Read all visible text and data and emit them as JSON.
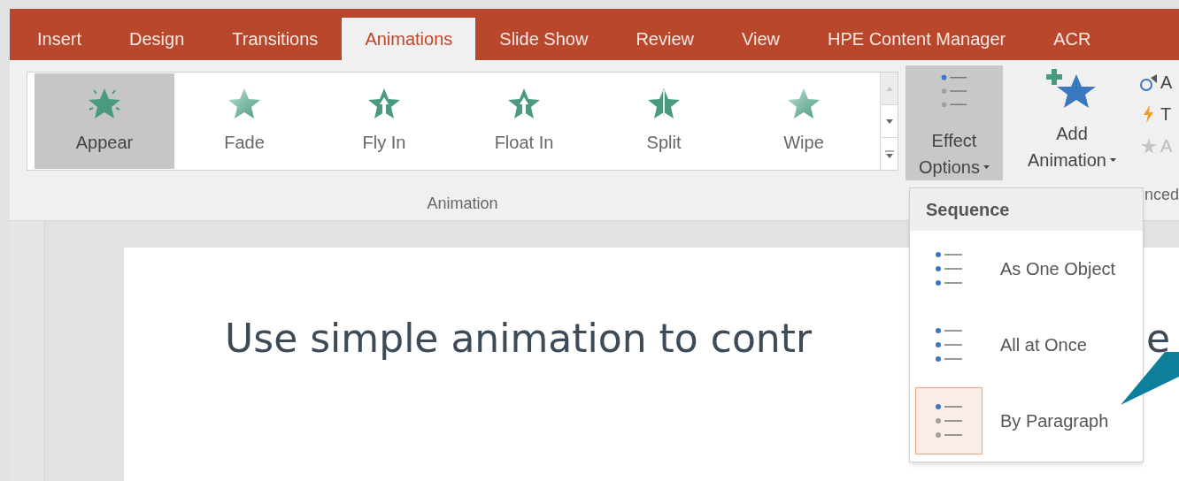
{
  "tabs": [
    {
      "label": "Insert",
      "selected": false
    },
    {
      "label": "Design",
      "selected": false
    },
    {
      "label": "Transitions",
      "selected": false
    },
    {
      "label": "Animations",
      "selected": true
    },
    {
      "label": "Slide Show",
      "selected": false
    },
    {
      "label": "Review",
      "selected": false
    },
    {
      "label": "View",
      "selected": false
    },
    {
      "label": "HPE Content Manager",
      "selected": false
    },
    {
      "label": "ACR",
      "selected": false
    }
  ],
  "animation_gallery": {
    "items": [
      {
        "label": "Appear",
        "kind": "appear",
        "selected": true
      },
      {
        "label": "Fade",
        "kind": "fade",
        "selected": false
      },
      {
        "label": "Fly In",
        "kind": "fly",
        "selected": false
      },
      {
        "label": "Float In",
        "kind": "float",
        "selected": false
      },
      {
        "label": "Split",
        "kind": "split",
        "selected": false
      },
      {
        "label": "Wipe",
        "kind": "wipe",
        "selected": false
      }
    ],
    "group_label": "Animation"
  },
  "effect_options": {
    "line1": "Effect",
    "line2": "Options",
    "selected": true
  },
  "add_animation": {
    "line1": "Add",
    "line2": "Animation"
  },
  "side_items": [
    {
      "kind": "timer",
      "label": "A",
      "disabled": false
    },
    {
      "kind": "trigger",
      "label": "T",
      "disabled": false
    },
    {
      "kind": "painter",
      "label": "A",
      "disabled": true
    }
  ],
  "advanced_group_label": "nced",
  "slide": {
    "title_visible": "Use simple animation to contr",
    "title_tail": "e"
  },
  "menu": {
    "header": "Sequence",
    "items": [
      {
        "label": "As One Object",
        "kind": "one",
        "selected": false
      },
      {
        "label": "All at Once",
        "kind": "all",
        "selected": false
      },
      {
        "label": "By Paragraph",
        "kind": "paragraph",
        "selected": true
      }
    ]
  }
}
